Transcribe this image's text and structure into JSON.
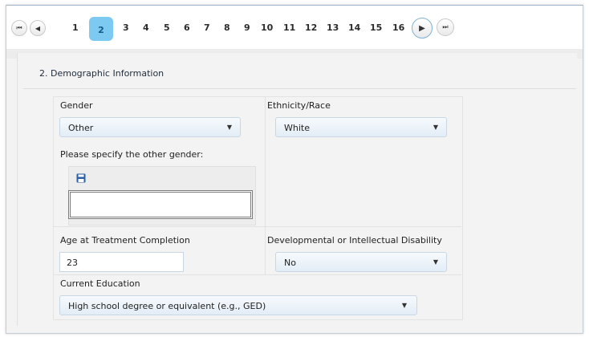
{
  "pager": {
    "first_icon": "first-page-icon",
    "prev_icon": "prev-page-icon",
    "next_icon": "next-page-icon",
    "last_icon": "last-page-icon",
    "pages": [
      "1",
      "2",
      "3",
      "4",
      "5",
      "6",
      "7",
      "8",
      "9",
      "10",
      "11",
      "12",
      "13",
      "14",
      "15",
      "16"
    ],
    "current_page": "2"
  },
  "section": {
    "title": "2. Demographic Information"
  },
  "form": {
    "gender": {
      "label": "Gender",
      "value": "Other"
    },
    "other_gender": {
      "label": "Please specify the other gender:",
      "value": "",
      "save_icon": "save-icon"
    },
    "ethnicity": {
      "label": "Ethnicity/Race",
      "value": "White"
    },
    "age": {
      "label": "Age at Treatment Completion",
      "value": "23"
    },
    "disability": {
      "label": "Developmental or Intellectual Disability",
      "value": "No"
    },
    "education": {
      "label": "Current Education",
      "value": "High school degree or equivalent (e.g., GED)"
    }
  },
  "colors": {
    "current_page_bg": "#7cc9f2",
    "select_bg": "#e3edf6",
    "frame_border": "#9fb4cc"
  }
}
